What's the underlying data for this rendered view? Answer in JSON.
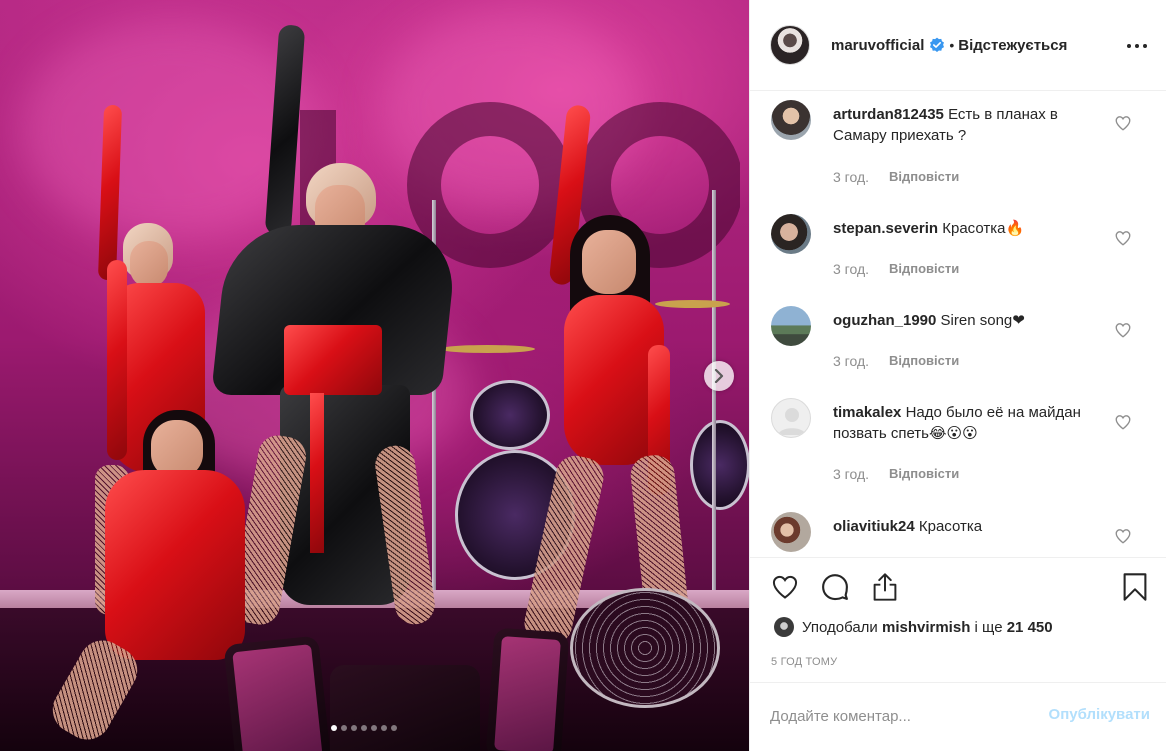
{
  "post": {
    "image_alt": "",
    "carousel_dots": 7,
    "carousel_active": 0,
    "next_icon": "chevron-right-icon"
  },
  "header": {
    "username": "maruvofficial",
    "verified_icon": "verified-badge-icon",
    "separator": "•",
    "follow_status": "Відстежується",
    "more_icon": "more-horizontal-icon"
  },
  "comments": [
    {
      "username": "arturdan812435",
      "text": "Есть в планах в Самару приехать ?",
      "time": "3 год.",
      "reply": "Відповісти"
    },
    {
      "username": "stepan.severin",
      "text": "Красотка🔥",
      "time": "3 год.",
      "reply": "Відповісти"
    },
    {
      "username": "oguzhan_1990",
      "text": "Siren song❤",
      "time": "3 год.",
      "reply": "Відповісти"
    },
    {
      "username": "timakalex",
      "text": "Надо было её на майдан позвать спеть😂😮😮",
      "time": "3 год.",
      "reply": "Відповісти"
    },
    {
      "username": "oliavitiuk24",
      "text": "Красотка",
      "time": "",
      "reply": ""
    }
  ],
  "actions": {
    "like_icon": "heart-icon",
    "comment_icon": "comment-icon",
    "share_icon": "share-icon",
    "save_icon": "bookmark-icon"
  },
  "likes": {
    "prefix": "Уподобали",
    "user": "mishvirmish",
    "middle": "і ще",
    "count": "21 450"
  },
  "timestamp": "5 ГОД ТОМУ",
  "comment_box": {
    "placeholder": "Додайте коментар...",
    "publish": "Опублікувати"
  },
  "colors": {
    "verified": "#3897f0",
    "publish_disabled": "#b2dffc",
    "heart_red": "#d0021b",
    "muted": "#8e8e8e"
  }
}
